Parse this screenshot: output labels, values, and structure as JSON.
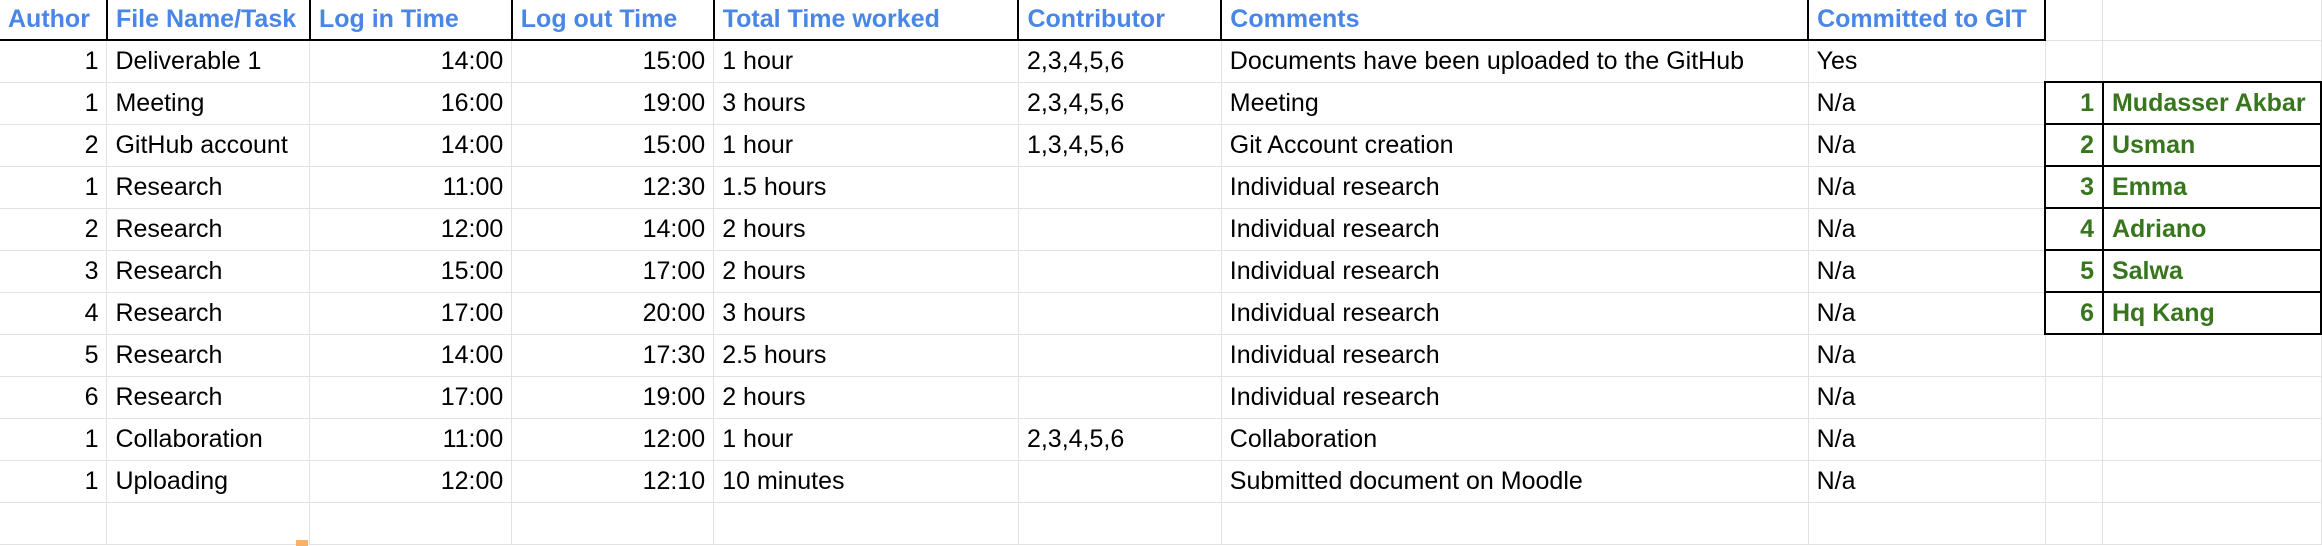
{
  "sheet": {
    "headers": [
      "Author",
      "File Name/Task",
      "Log in Time",
      "Log out Time",
      "Total Time worked",
      "Contributor",
      "Comments",
      "Committed to GIT"
    ],
    "rows": [
      {
        "author": "1",
        "task": "Deliverable 1",
        "login": "14:00",
        "logout": "15:00",
        "total": "1 hour",
        "contributor": "2,3,4,5,6",
        "comments": "Documents have been uploaded to the GitHub",
        "git": "Yes"
      },
      {
        "author": "1",
        "task": "Meeting",
        "login": "16:00",
        "logout": "19:00",
        "total": "3 hours",
        "contributor": "2,3,4,5,6",
        "comments": "Meeting",
        "git": "N/a"
      },
      {
        "author": "2",
        "task": "GitHub account",
        "login": "14:00",
        "logout": "15:00",
        "total": "1 hour",
        "contributor": "1,3,4,5,6",
        "comments": "Git Account creation",
        "git": "N/a"
      },
      {
        "author": "1",
        "task": "Research",
        "login": "11:00",
        "logout": "12:30",
        "total": "1.5 hours",
        "contributor": "",
        "comments": "Individual research",
        "git": "N/a"
      },
      {
        "author": "2",
        "task": "Research",
        "login": "12:00",
        "logout": "14:00",
        "total": "2 hours",
        "contributor": "",
        "comments": "Individual research",
        "git": "N/a"
      },
      {
        "author": "3",
        "task": "Research",
        "login": "15:00",
        "logout": "17:00",
        "total": "2 hours",
        "contributor": "",
        "comments": "Individual research",
        "git": "N/a"
      },
      {
        "author": "4",
        "task": "Research",
        "login": "17:00",
        "logout": "20:00",
        "total": "3 hours",
        "contributor": "",
        "comments": "Individual research",
        "git": "N/a"
      },
      {
        "author": "5",
        "task": "Research",
        "login": "14:00",
        "logout": "17:30",
        "total": "2.5 hours",
        "contributor": "",
        "comments": "Individual research",
        "git": "N/a"
      },
      {
        "author": "6",
        "task": "Research",
        "login": "17:00",
        "logout": "19:00",
        "total": "2 hours",
        "contributor": "",
        "comments": "Individual research",
        "git": "N/a"
      },
      {
        "author": "1",
        "task": "Collaboration",
        "login": "11:00",
        "logout": "12:00",
        "total": "1 hour",
        "contributor": "2,3,4,5,6",
        "comments": "Collaboration",
        "git": "N/a"
      },
      {
        "author": "1",
        "task": "Uploading",
        "login": "12:00",
        "logout": "12:10",
        "total": "10 minutes",
        "contributor": "",
        "comments": "Submitted document on Moodle",
        "git": "N/a"
      }
    ],
    "members": [
      {
        "id": "1",
        "name": "Mudasser Akbar"
      },
      {
        "id": "2",
        "name": "Usman"
      },
      {
        "id": "3",
        "name": "Emma"
      },
      {
        "id": "4",
        "name": "Adriano"
      },
      {
        "id": "5",
        "name": "Salwa"
      },
      {
        "id": "6",
        "name": "Hq Kang"
      }
    ]
  },
  "colors": {
    "header_text": "#4a86e8",
    "member_text": "#38761d",
    "gridline": "#e2e2e2",
    "fill_handle": "#f6b26b"
  }
}
